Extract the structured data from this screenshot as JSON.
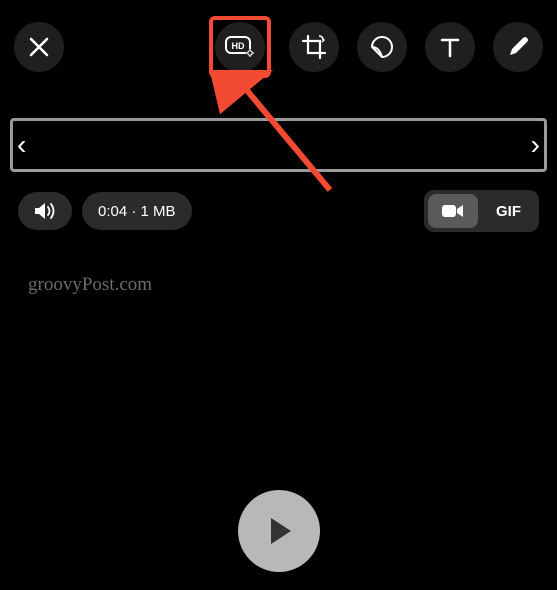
{
  "toolbar": {
    "close": "close",
    "hd": "hd-quality",
    "crop": "crop-rotate",
    "sticker": "sticker",
    "text": "text",
    "draw": "draw"
  },
  "trim": {
    "left_handle": "‹",
    "right_handle": "›"
  },
  "info": {
    "sound_icon": "sound-on",
    "duration_size": "0:04 · 1 MB"
  },
  "format": {
    "video_icon": "video",
    "gif_label": "GIF"
  },
  "watermark": "groovyPost.com",
  "play": "play"
}
